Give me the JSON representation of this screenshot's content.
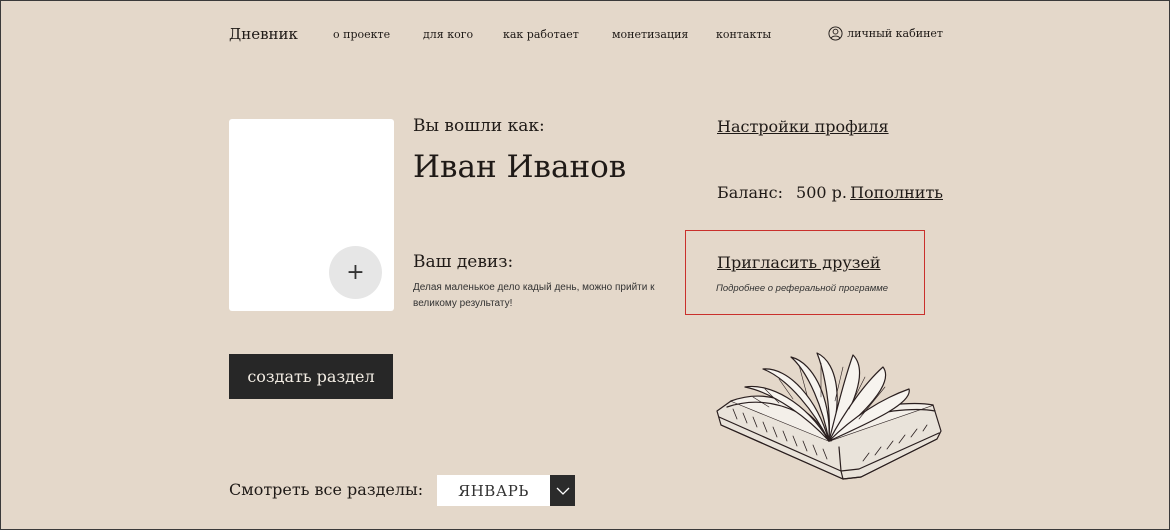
{
  "header": {
    "logo": "Дневник",
    "nav": [
      {
        "label": "о проекте"
      },
      {
        "label": "для кого"
      },
      {
        "label": "как работает"
      },
      {
        "label": "монетизация"
      },
      {
        "label": "контакты"
      }
    ],
    "account_label": "личный кабинет",
    "account_icon": "user-circle-icon"
  },
  "profile": {
    "logged_in_label": "Вы вошли как:",
    "name": "Иван Иванов",
    "add_photo_icon": "plus-icon",
    "add_photo_symbol": "+",
    "motto_label": "Ваш девиз:",
    "motto_text": "Делая маленькое дело кадый день, можно прийти к великому результату!"
  },
  "account": {
    "settings_link": "Настройки профиля",
    "balance_label": "Баланс:",
    "balance_value": "500 р.",
    "top_up_link": "Пополнить",
    "invite_link": "Пригласить друзей",
    "invite_subtitle": "Подробнее о реферальной программе",
    "highlight_color": "#c9302c"
  },
  "actions": {
    "create_section": "создать раздел"
  },
  "sections_filter": {
    "label": "Смотреть  все разделы:",
    "selected_month": "ЯНВАРЬ",
    "dropdown_icon": "chevron-down-icon"
  },
  "illustration": {
    "icon": "open-book-icon"
  },
  "colors": {
    "background": "#e4d8ca",
    "dark": "#272727"
  }
}
